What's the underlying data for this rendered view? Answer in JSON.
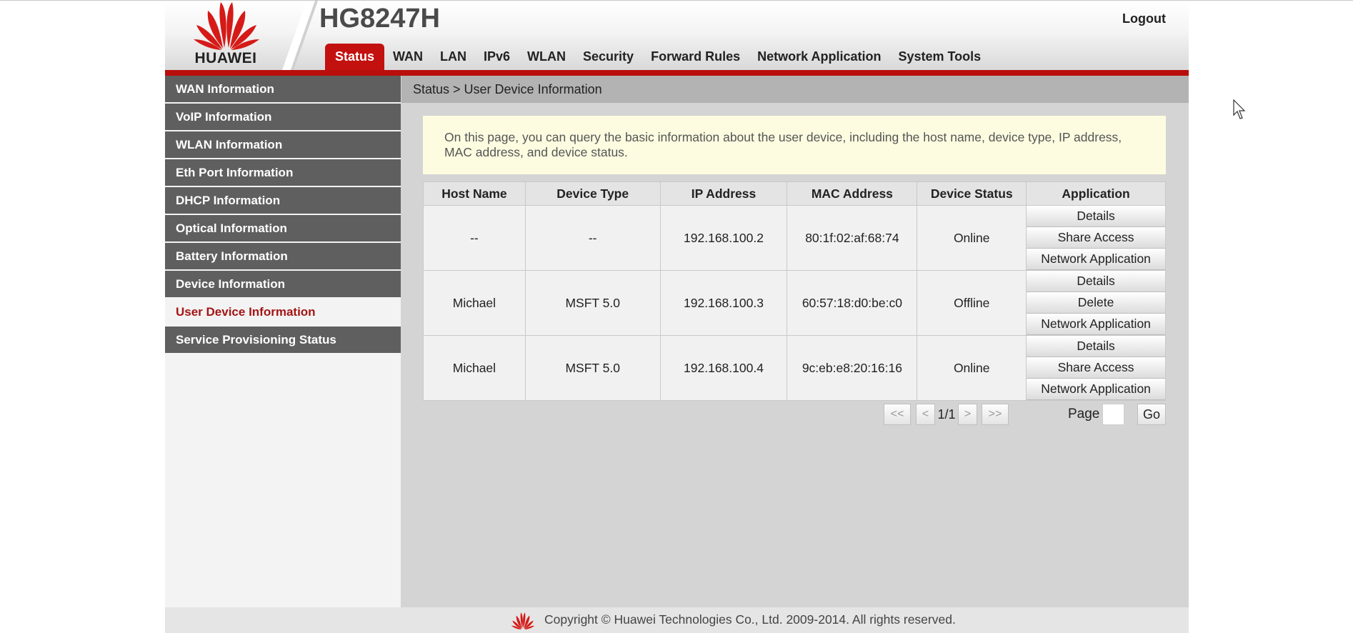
{
  "header": {
    "brand": "HUAWEI",
    "model": "HG8247H",
    "logout_label": "Logout"
  },
  "nav": {
    "items": [
      "Status",
      "WAN",
      "LAN",
      "IPv6",
      "WLAN",
      "Security",
      "Forward Rules",
      "Network Application",
      "System Tools"
    ],
    "active": "Status"
  },
  "sidebar": {
    "items": [
      "WAN Information",
      "VoIP Information",
      "WLAN Information",
      "Eth Port Information",
      "DHCP Information",
      "Optical Information",
      "Battery Information",
      "Device Information",
      "User Device Information",
      "Service Provisioning Status"
    ],
    "active": "User Device Information"
  },
  "breadcrumb": "Status > User Device Information",
  "notice": "On this page, you can query the basic information about the user device, including the host name, device type, IP address, MAC address, and device status.",
  "table": {
    "headers": [
      "Host Name",
      "Device Type",
      "IP Address",
      "MAC Address",
      "Device Status",
      "Application"
    ],
    "rows": [
      {
        "host": "--",
        "type": "--",
        "ip": "192.168.100.2",
        "mac": "80:1f:02:af:68:74",
        "status": "Online",
        "actions": [
          "Details",
          "Share Access",
          "Network Application"
        ]
      },
      {
        "host": "Michael",
        "type": "MSFT 5.0",
        "ip": "192.168.100.3",
        "mac": "60:57:18:d0:be:c0",
        "status": "Offline",
        "actions": [
          "Details",
          "Delete",
          "Network Application"
        ]
      },
      {
        "host": "Michael",
        "type": "MSFT 5.0",
        "ip": "192.168.100.4",
        "mac": "9c:eb:e8:20:16:16",
        "status": "Online",
        "actions": [
          "Details",
          "Share Access",
          "Network Application"
        ]
      }
    ]
  },
  "pagination": {
    "first": "<<",
    "prev": "<",
    "info": "1/1",
    "next": ">",
    "last": ">>",
    "page_label": "Page",
    "page_value": "",
    "go_label": "Go"
  },
  "footer": {
    "copyright": "Copyright © Huawei Technologies Co., Ltd. 2009-2014. All rights reserved."
  },
  "colors": {
    "accent_red": "#c3110f",
    "sidebar_bg": "#5f5f5f",
    "notice_bg": "#fdfce0"
  }
}
